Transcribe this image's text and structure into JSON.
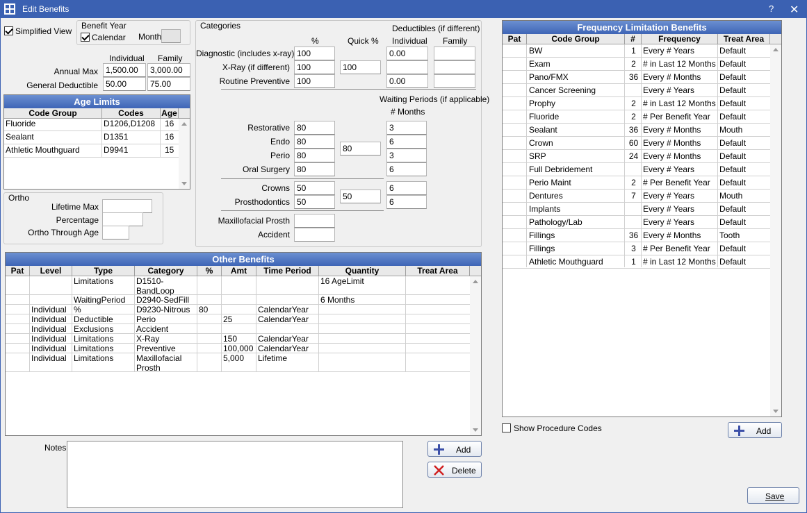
{
  "window": {
    "title": "Edit Benefits",
    "help": "?",
    "close": "✕"
  },
  "simplified_view": {
    "label": "Simplified View",
    "checked": true
  },
  "benefit_year": {
    "title": "Benefit Year",
    "calendar_label": "Calendar",
    "calendar_checked": true,
    "month_label": "Month",
    "month_value": ""
  },
  "amounts": {
    "individual_header": "Individual",
    "family_header": "Family",
    "annual_max_label": "Annual Max",
    "annual_max_individual": "1,500.00",
    "annual_max_family": "3,000.00",
    "general_deductible_label": "General Deductible",
    "general_deductible_individual": "50.00",
    "general_deductible_family": "75.00"
  },
  "age_limits": {
    "title": "Age Limits",
    "columns": [
      "Code Group",
      "Codes",
      "Age"
    ],
    "rows": [
      [
        "Fluoride",
        "D1206,D1208",
        "16"
      ],
      [
        "Sealant",
        "D1351",
        "16"
      ],
      [
        "Athletic Mouthguard",
        "D9941",
        "15"
      ]
    ]
  },
  "ortho": {
    "title": "Ortho",
    "lifetime_max_label": "Lifetime Max",
    "lifetime_max_value": "",
    "percentage_label": "Percentage",
    "percentage_value": "",
    "through_age_label": "Ortho Through Age",
    "through_age_value": ""
  },
  "categories": {
    "title": "Categories",
    "deductibles_title": "Deductibles (if different)",
    "pct_header": "%",
    "quick_pct_header": "Quick %",
    "ded_individual_header": "Individual",
    "ded_family_header": "Family",
    "diagnostic_label": "Diagnostic (includes x-ray)",
    "diagnostic_pct": "100",
    "diagnostic_ded_individual": "0.00",
    "diagnostic_ded_family": "",
    "xray_label": "X-Ray (if different)",
    "xray_pct": "100",
    "xray_quick": "100",
    "xray_ded_individual": "",
    "xray_ded_family": "",
    "routine_label": "Routine Preventive",
    "routine_pct": "100",
    "routine_ded_individual": "0.00",
    "routine_ded_family": "",
    "waiting_title": "Waiting Periods (if applicable)",
    "months_header": "# Months",
    "restorative_label": "Restorative",
    "restorative_pct": "80",
    "restorative_months": "3",
    "endo_label": "Endo",
    "endo_pct": "80",
    "endo_months": "6",
    "basic_quick": "80",
    "perio_label": "Perio",
    "perio_pct": "80",
    "perio_months": "3",
    "oral_surgery_label": "Oral Surgery",
    "oral_surgery_pct": "80",
    "oral_surgery_months": "6",
    "crowns_label": "Crowns",
    "crowns_pct": "50",
    "crowns_months": "6",
    "major_quick": "50",
    "prostho_label": "Prosthodontics",
    "prostho_pct": "50",
    "prostho_months": "6",
    "maxillofacial_label": "Maxillofacial Prosth",
    "maxillofacial_pct": "",
    "accident_label": "Accident",
    "accident_pct": ""
  },
  "other_benefits": {
    "title": "Other Benefits",
    "columns": [
      "Pat",
      "Level",
      "Type",
      "Category",
      "%",
      "Amt",
      "Time Period",
      "Quantity",
      "Treat Area"
    ],
    "rows": [
      [
        "",
        "",
        "Limitations",
        "D1510-\nBandLoop",
        "",
        "",
        "",
        "16 AgeLimit",
        ""
      ],
      [
        "",
        "",
        "WaitingPeriod",
        "D2940-SedFill",
        "",
        "",
        "",
        "6 Months",
        ""
      ],
      [
        "",
        "Individual",
        "%",
        "D9230-Nitrous",
        "80",
        "",
        "CalendarYear",
        "",
        ""
      ],
      [
        "",
        "Individual",
        "Deductible",
        "Perio",
        "",
        "25",
        "CalendarYear",
        "",
        ""
      ],
      [
        "",
        "Individual",
        "Exclusions",
        "Accident",
        "",
        "",
        "",
        "",
        ""
      ],
      [
        "",
        "Individual",
        "Limitations",
        "X-Ray",
        "",
        "150",
        "CalendarYear",
        "",
        ""
      ],
      [
        "",
        "Individual",
        "Limitations",
        "Preventive",
        "",
        "100,000",
        "CalendarYear",
        "",
        ""
      ],
      [
        "",
        "Individual",
        "Limitations",
        "Maxillofacial\nProsth",
        "",
        "5,000",
        "Lifetime",
        "",
        ""
      ]
    ]
  },
  "notes": {
    "label": "Notes",
    "value": ""
  },
  "buttons": {
    "add": "Add",
    "delete": "Delete",
    "freq_add": "Add",
    "save": "Save"
  },
  "frequency": {
    "title": "Frequency Limitation Benefits",
    "columns": [
      "Pat",
      "Code Group",
      "#",
      "Frequency",
      "Treat Area"
    ],
    "rows": [
      [
        "",
        "BW",
        "1",
        "Every # Years",
        "Default"
      ],
      [
        "",
        "Exam",
        "2",
        "# in Last 12 Months",
        "Default"
      ],
      [
        "",
        "Pano/FMX",
        "36",
        "Every # Months",
        "Default"
      ],
      [
        "",
        "Cancer Screening",
        "",
        "Every # Years",
        "Default"
      ],
      [
        "",
        "Prophy",
        "2",
        "# in Last 12 Months",
        "Default"
      ],
      [
        "",
        "Fluoride",
        "2",
        "# Per Benefit Year",
        "Default"
      ],
      [
        "",
        "Sealant",
        "36",
        "Every # Months",
        "Mouth"
      ],
      [
        "",
        "Crown",
        "60",
        "Every # Months",
        "Default"
      ],
      [
        "",
        "SRP",
        "24",
        "Every # Months",
        "Default"
      ],
      [
        "",
        "Full Debridement",
        "",
        "Every # Years",
        "Default"
      ],
      [
        "",
        "Perio Maint",
        "2",
        "# Per Benefit Year",
        "Default"
      ],
      [
        "",
        "Dentures",
        "7",
        "Every # Years",
        "Mouth"
      ],
      [
        "",
        "Implants",
        "",
        "Every # Years",
        "Default"
      ],
      [
        "",
        "Pathology/Lab",
        "",
        "Every # Years",
        "Default"
      ],
      [
        "",
        "Fillings",
        "36",
        "Every # Months",
        "Tooth"
      ],
      [
        "",
        "Fillings",
        "3",
        "# Per Benefit Year",
        "Default"
      ],
      [
        "",
        "Athletic Mouthguard",
        "1",
        "# in Last 12 Months",
        "Default"
      ]
    ]
  },
  "show_procedure_codes": {
    "label": "Show Procedure Codes",
    "checked": false
  }
}
